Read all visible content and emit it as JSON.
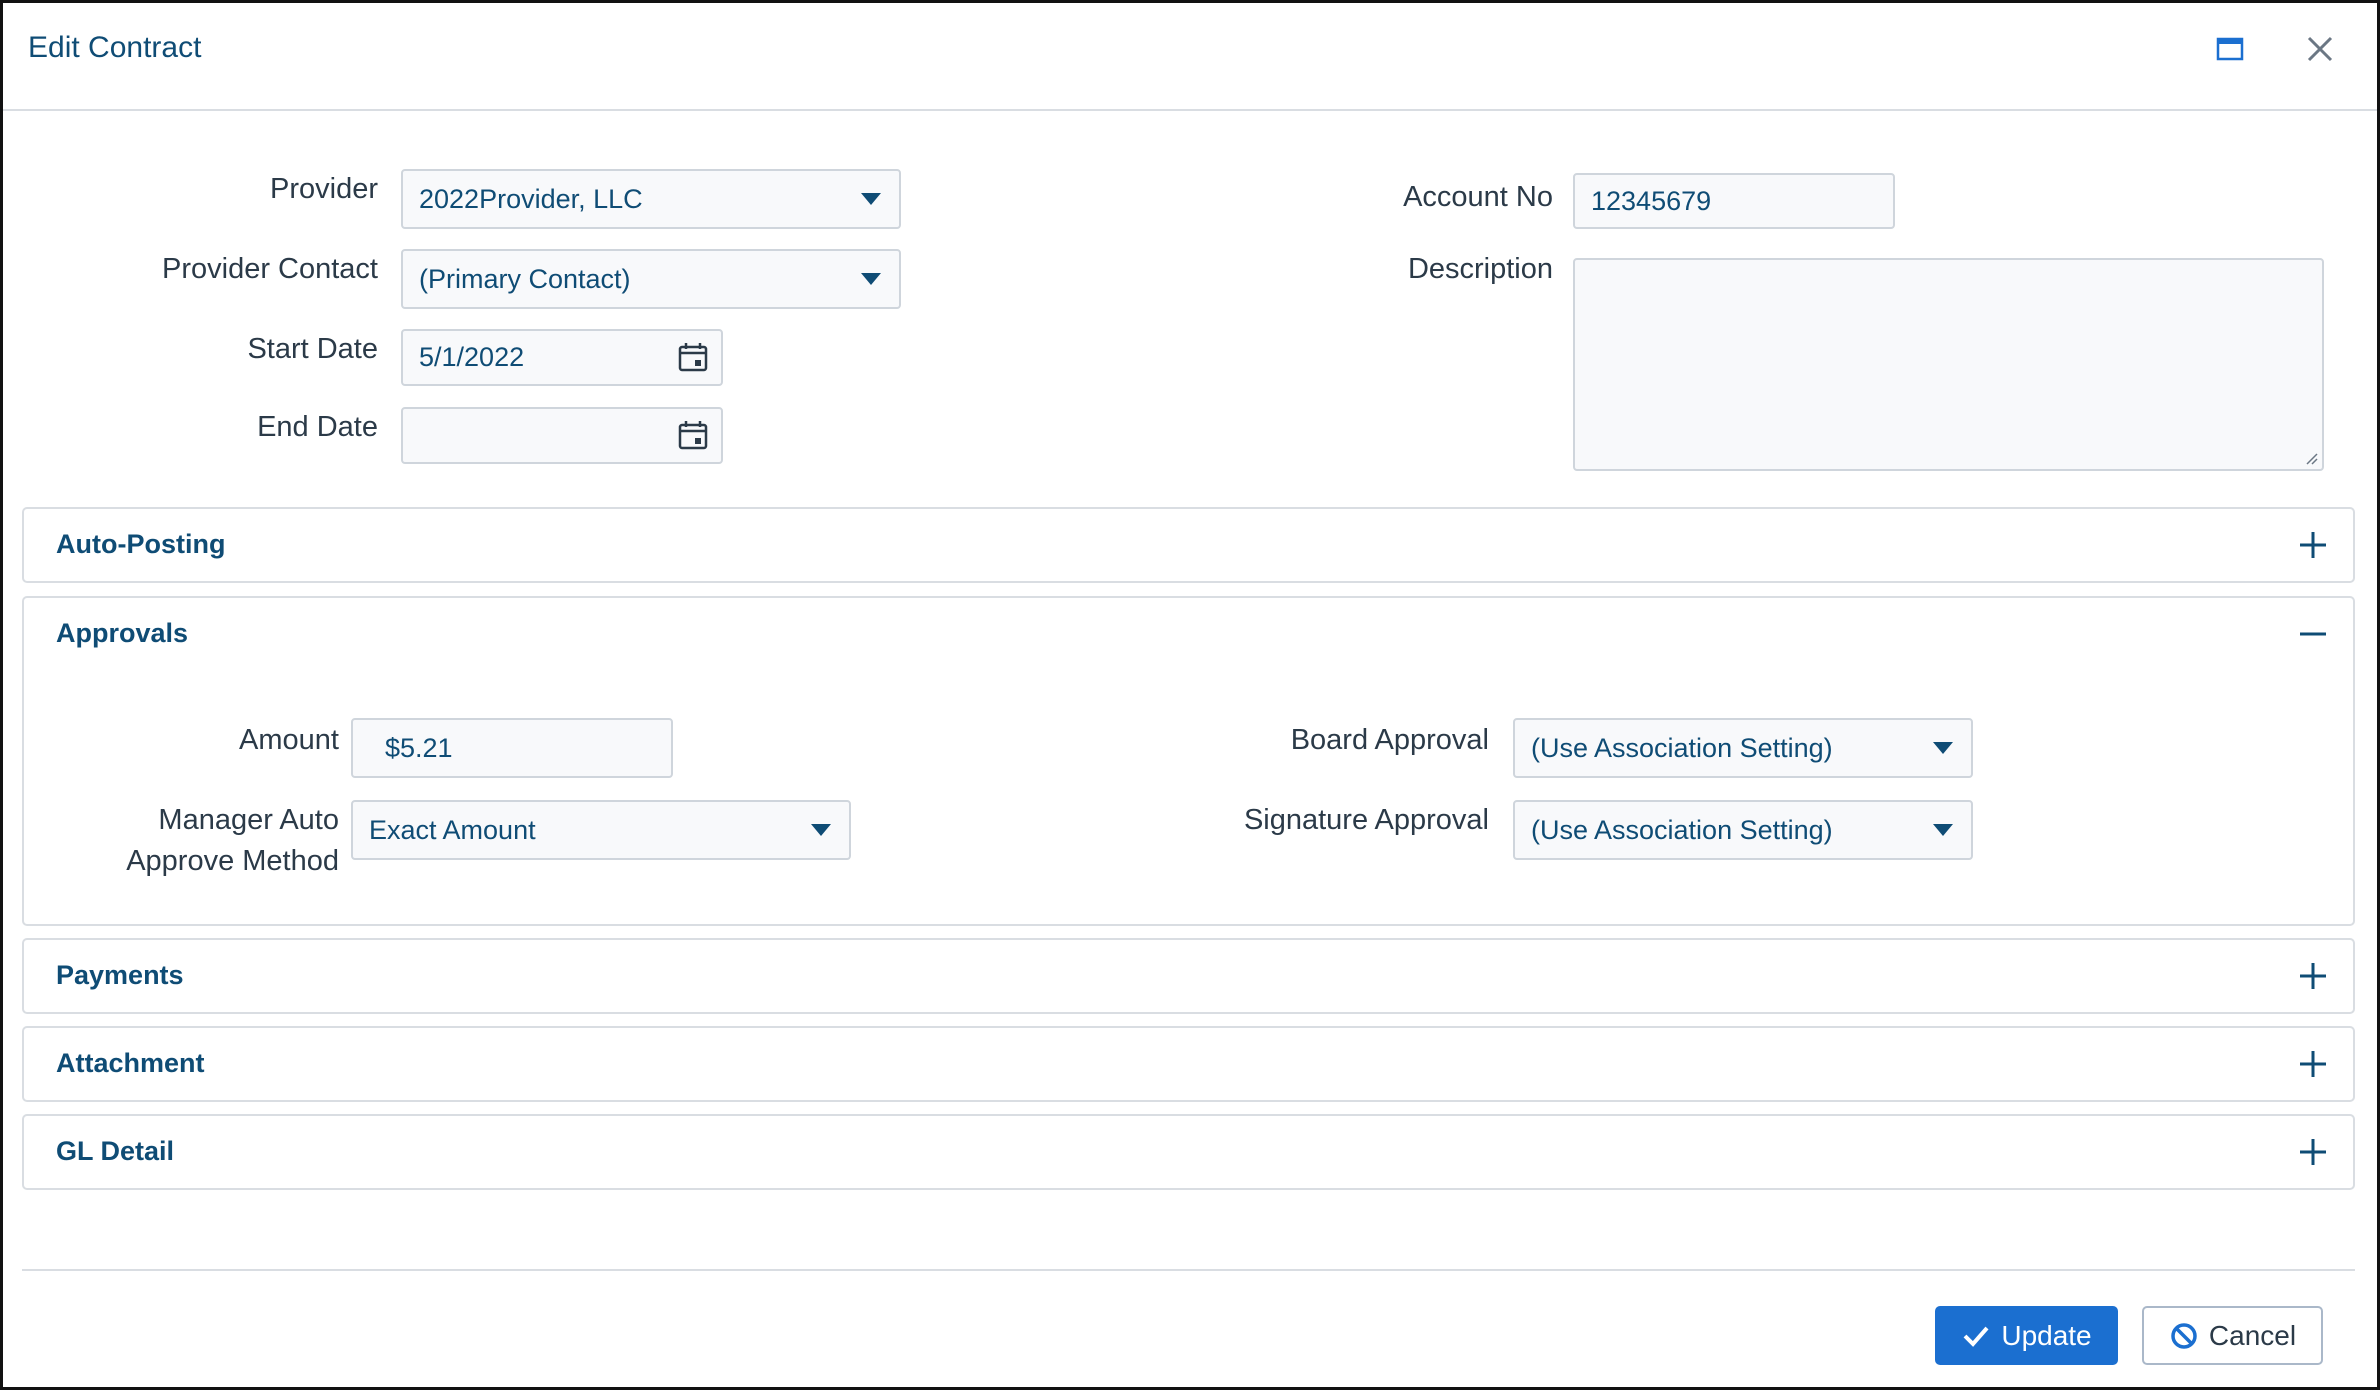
{
  "dialog": {
    "title": "Edit Contract",
    "maximize_icon": "window-maximize-icon",
    "close_icon": "close-icon"
  },
  "form": {
    "provider_label": "Provider",
    "provider_value": "2022Provider, LLC",
    "provider_contact_label": "Provider Contact",
    "provider_contact_value": "(Primary Contact)",
    "start_date_label": "Start Date",
    "start_date_value": "5/1/2022",
    "end_date_label": "End Date",
    "end_date_value": "",
    "account_no_label": "Account No",
    "account_no_value": "12345679",
    "description_label": "Description",
    "description_value": ""
  },
  "panels": {
    "auto_posting": {
      "title": "Auto-Posting",
      "state": "collapsed"
    },
    "approvals": {
      "title": "Approvals",
      "state": "expanded",
      "amount_label": "Amount",
      "amount_value": "$5.21",
      "manager_label_line1": "Manager Auto",
      "manager_label_line2": "Approve Method",
      "manager_value": "Exact Amount",
      "board_label": "Board Approval",
      "board_value": "(Use Association Setting)",
      "signature_label": "Signature Approval",
      "signature_value": "(Use Association Setting)"
    },
    "payments": {
      "title": "Payments",
      "state": "collapsed"
    },
    "attachment": {
      "title": "Attachment",
      "state": "collapsed"
    },
    "gl_detail": {
      "title": "GL Detail",
      "state": "collapsed"
    }
  },
  "footer": {
    "update_label": "Update",
    "cancel_label": "Cancel",
    "update_icon": "check-icon",
    "cancel_icon": "ban-icon"
  },
  "colors": {
    "accent": "#1b6fd0",
    "text_primary": "#0f4c75",
    "label": "#2b3a48",
    "border": "#cfd5dc",
    "field_bg": "#f8f9fb"
  }
}
